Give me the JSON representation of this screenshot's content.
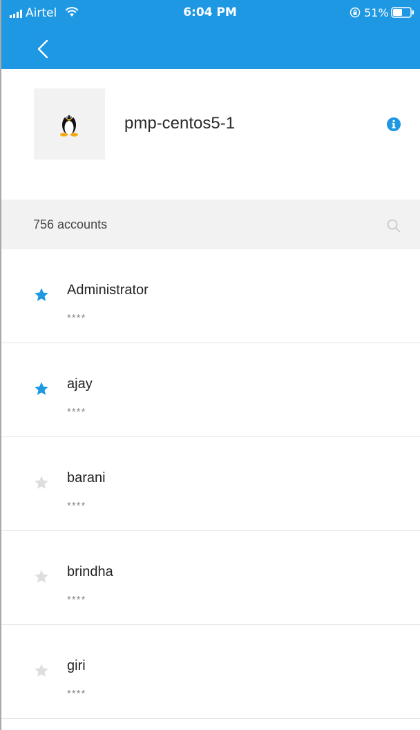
{
  "status_bar": {
    "carrier": "Airtel",
    "time": "6:04 PM",
    "battery": "51%"
  },
  "device": {
    "name": "pmp-centos5-1",
    "os_icon": "linux-tux-icon"
  },
  "accounts": {
    "count_label": "756 accounts",
    "items": [
      {
        "name": "Administrator",
        "password": "****",
        "favorite": true
      },
      {
        "name": "ajay",
        "password": "****",
        "favorite": true
      },
      {
        "name": "barani",
        "password": "****",
        "favorite": false
      },
      {
        "name": "brindha",
        "password": "****",
        "favorite": false
      },
      {
        "name": "giri",
        "password": "****",
        "favorite": false
      }
    ]
  },
  "icons": {
    "back": "chevron-left-icon",
    "info": "info-icon",
    "search": "search-icon",
    "star": "star-icon"
  },
  "colors": {
    "header": "#1f98e3",
    "accent": "#1f98e3",
    "star_inactive": "#dedede",
    "section_bg": "#f2f2f2"
  }
}
